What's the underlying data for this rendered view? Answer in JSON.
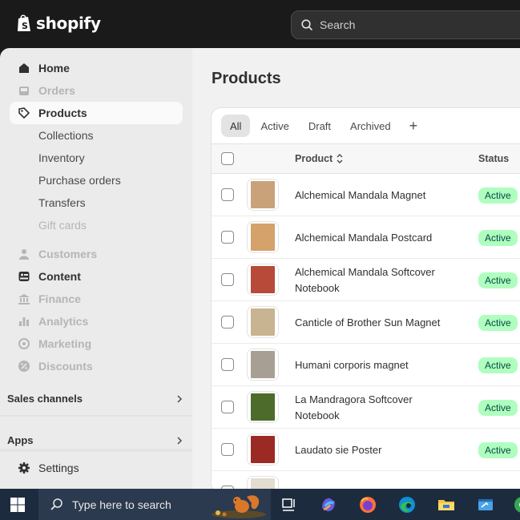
{
  "app": {
    "logo_text": "shopify"
  },
  "search": {
    "placeholder": "Search"
  },
  "sidebar": {
    "items": [
      {
        "label": "Home"
      },
      {
        "label": "Orders"
      },
      {
        "label": "Products"
      },
      {
        "label": "Collections"
      },
      {
        "label": "Inventory"
      },
      {
        "label": "Purchase orders"
      },
      {
        "label": "Transfers"
      },
      {
        "label": "Gift cards"
      },
      {
        "label": "Customers"
      },
      {
        "label": "Content"
      },
      {
        "label": "Finance"
      },
      {
        "label": "Analytics"
      },
      {
        "label": "Marketing"
      },
      {
        "label": "Discounts"
      }
    ],
    "sales_channels": "Sales channels",
    "apps": "Apps",
    "settings": "Settings"
  },
  "main": {
    "title": "Products",
    "tabs": [
      "All",
      "Active",
      "Draft",
      "Archived",
      "+"
    ],
    "columns": {
      "product": "Product",
      "status": "Status"
    },
    "rows": [
      {
        "name": "Alchemical Mandala Magnet",
        "status": "Active",
        "color": "#c9a27a"
      },
      {
        "name": "Alchemical Mandala Postcard",
        "status": "Active",
        "color": "#d4a26a"
      },
      {
        "name": "Alchemical Mandala Softcover Notebook",
        "status": "Active",
        "color": "#b84a3a"
      },
      {
        "name": "Canticle of Brother Sun Magnet",
        "status": "Active",
        "color": "#c8b491"
      },
      {
        "name": "Humani corporis magnet",
        "status": "Active",
        "color": "#a79f93"
      },
      {
        "name": "La Mandragora Softcover Notebook",
        "status": "Active",
        "color": "#4d6b2a"
      },
      {
        "name": "Laudato sie Poster",
        "status": "Active",
        "color": "#9b2a24"
      },
      {
        "name": "",
        "status": "",
        "color": "#e3dccf"
      }
    ]
  },
  "taskbar": {
    "search_placeholder": "Type here to search"
  },
  "colors": {
    "accent_badge_bg": "#affebf",
    "accent_badge_text": "#014b40"
  }
}
